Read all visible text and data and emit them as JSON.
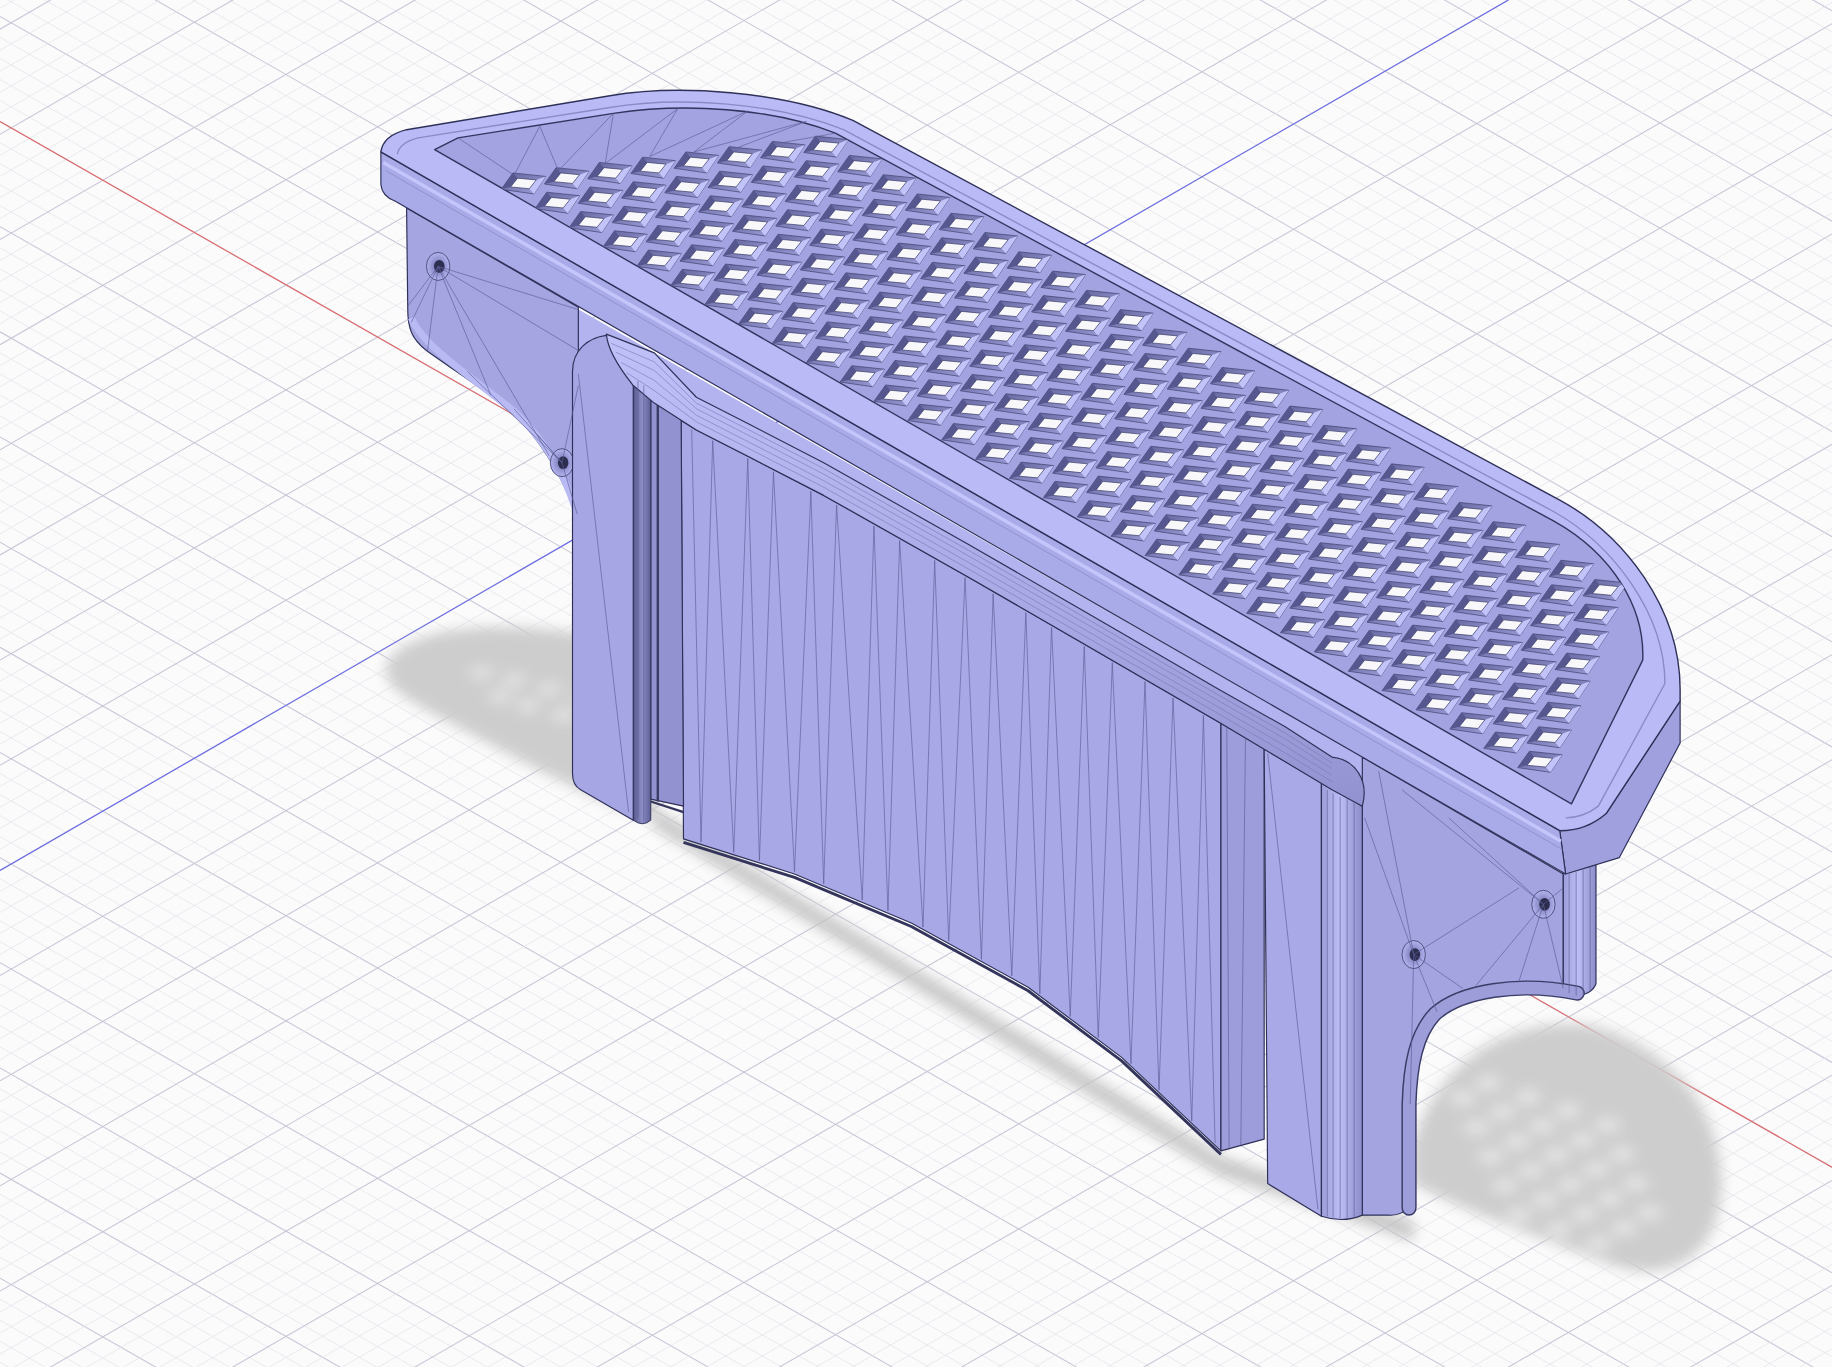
{
  "viewport": {
    "grid": {
      "visible": true
    },
    "axes": [
      {
        "kind": "x",
        "color": "#e06c6c"
      },
      {
        "kind": "y",
        "color": "#6c6ce6"
      }
    ],
    "model": {
      "kind": "part",
      "shadow": true,
      "mesh_edges": true
    }
  }
}
